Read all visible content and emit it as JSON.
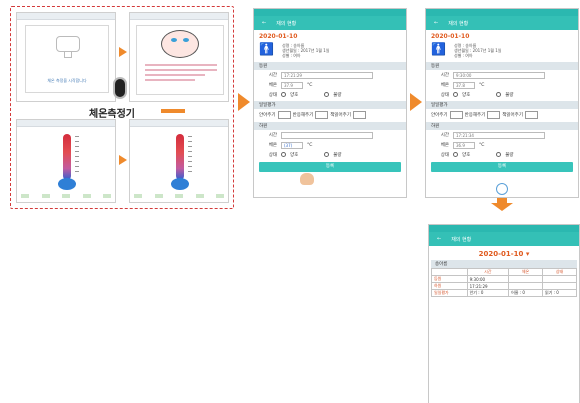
{
  "device": {
    "sensor_label": "체온측정기",
    "screen1_text": "체온 측정을 시작합니다"
  },
  "form": {
    "app_title": "재의 현황",
    "date": "2020-01-10",
    "person": {
      "name": "성명 : 송아름",
      "birth": "생년월일 : 2017년 1월 1일",
      "gender": "성별 : 여아"
    },
    "sections": {
      "arrival": "등원",
      "care": "일일평가",
      "departure": "하원"
    },
    "labels": {
      "time": "시간",
      "temp": "체온",
      "condition": "상태",
      "unit": "°C",
      "good": "양호",
      "bad": "불량",
      "crying": "안아주기",
      "fever": "반응해주기",
      "play": "책읽어주기",
      "submit": "등록"
    }
  },
  "screen_a": {
    "arrival_time": "17:21:29",
    "arrival_temp": "37.9",
    "departure_time": "",
    "departure_temp": "(37)"
  },
  "screen_b": {
    "arrival_time": "9:30:00",
    "arrival_temp": "37.8",
    "departure_time": "17:21:34",
    "departure_temp": "36.9"
  },
  "result": {
    "app_title": "재의 현황",
    "date": "2020-01-10 ▾",
    "name": "송아름",
    "headers": [
      "",
      "시간",
      "체온",
      "상태"
    ],
    "rows": [
      [
        "등원",
        "9:30:00",
        "",
        ""
      ],
      [
        "하원",
        "17:21:29",
        "",
        ""
      ]
    ],
    "eval_label": "일일평가",
    "eval_items": [
      "안기 : 0",
      "어울 : 0",
      "읽기 : 0"
    ]
  },
  "colors": {
    "accent": "#34c0b6",
    "arrow": "#ef8a2c",
    "date": "#e05a1e",
    "dashed": "#d33a3a"
  }
}
